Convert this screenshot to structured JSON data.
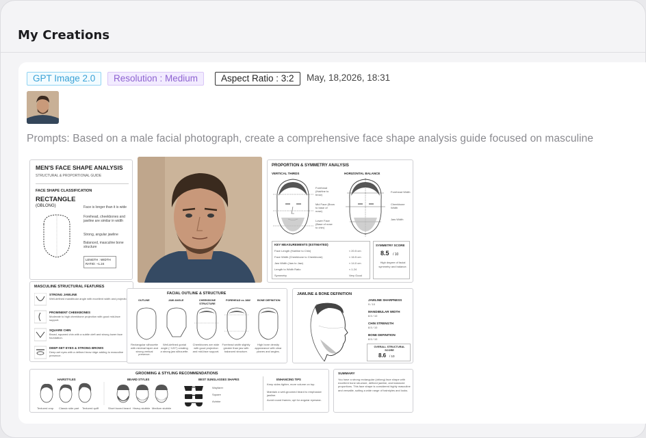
{
  "header": {
    "title": "My Creations"
  },
  "creation": {
    "model_tag": "GPT Image 2.0",
    "resolution_tag": "Resolution : Medium",
    "ratio_tag": "Aspect Ratio : 3:2",
    "date": "May, 18,2026, 18:31",
    "prompt": "Prompts: Based on a male facial photograph, create a comprehensive face shape analysis guide focused on masculine"
  },
  "poster": {
    "title": "MEN'S FACE SHAPE ANALYSIS",
    "subtitle": "STRUCTURAL & PROPORTIONAL GUIDE",
    "classification_heading": "FACE SHAPE CLASSIFICATION",
    "shape_name": "RECTANGLE",
    "shape_alt": "(OBLONG)",
    "shape_points": [
      "Face is longer than it is wide",
      "Forehead, cheekbones and jawline are similar in width",
      "Strong, angular jawline",
      "Balanced, masculine bone structure"
    ],
    "ratio_label": "LENGTH : WIDTH RATIO: ~1.24",
    "proportion_title": "PROPORTION & SYMMETRY ANALYSIS",
    "vertical_thirds": "VERTICAL THIRDS",
    "horizontal_balance": "HORIZONTAL BALANCE",
    "thirds_labels": [
      "Forehead (Hairline to brow)",
      "Mid Face (Brow to base of nose)",
      "Lower Face (Base of nose to chin)"
    ],
    "balance_labels": [
      "Forehead Width",
      "Cheekbone Width",
      "Jaw Width"
    ],
    "measure_heading": "KEY MEASUREMENTS (ESTIMATED)",
    "measurements": [
      {
        "label": "Face Length (Hairline to Chin)",
        "value": "≈ 20.5 cm"
      },
      {
        "label": "Face Width (Cheekbone to Cheekbone)",
        "value": "≈ 16.5 cm"
      },
      {
        "label": "Jaw Width (Jaw to Jaw)",
        "value": "≈ 14.0 cm"
      },
      {
        "label": "Length to Width Ratio",
        "value": "≈ 1.24"
      },
      {
        "label": "Symmetry",
        "value": "Very Good"
      }
    ],
    "symmetry_heading": "SYMMETRY SCORE",
    "symmetry_score": "8.5",
    "symmetry_outof": "/ 10",
    "symmetry_note": "High degree of facial symmetry and balance.",
    "features_title": "MASCULINE STRUCTURAL FEATURES",
    "features": [
      {
        "name": "STRONG JAWLINE",
        "desc": "Well-defined mandibular angle with excellent width and projection."
      },
      {
        "name": "PROMINENT CHEEKBONES",
        "desc": "Moderate to high cheekbone projection with good mid-face support."
      },
      {
        "name": "SQUARE CHIN",
        "desc": "Broad, squared chin with a subtle cleft and strong lower face foundation."
      },
      {
        "name": "DEEP-SET EYES & STRONG BROWS",
        "desc": "Deep-set eyes with a defined brow ridge adding to masculine presence."
      }
    ],
    "outline_title": "FACIAL OUTLINE & STRUCTURE",
    "outline_cols": [
      "OUTLINE",
      "JAW ANGLE",
      "CHEEKBONE STRUCTURE",
      "FOREHEAD vs JAW",
      "BONE DEFINITION"
    ],
    "outline_notes": [
      "Rectangular silhouette with minimal taper and strong vertical presence.",
      "Well-defined gonial angle (~120°) creating a strong jaw silhouette.",
      "Cheekbones are wide with good projection and mid-face support.",
      "Forehead width slightly greater than jaw with balanced structure.",
      "High bone density appearance with clear planes and angles."
    ],
    "jaw_title": "JAWLINE & BONE DEFINITION",
    "jaw_metrics": [
      {
        "label": "JAWLINE SHARPNESS",
        "value": "9 / 10"
      },
      {
        "label": "MANDIBULAR WIDTH",
        "value": "8.5 / 10"
      },
      {
        "label": "CHIN STRENGTH",
        "value": "8.5 / 10"
      },
      {
        "label": "BONE DEFINITION",
        "value": "8.5 / 10"
      }
    ],
    "overall_label": "OVERALL STRUCTURAL SCORE",
    "overall_score": "8.6",
    "overall_outof": "/ 10",
    "grooming_title": "GROOMING & STYLING RECOMMENDATIONS",
    "hairstyles_heading": "HAIRSTYLES",
    "hairstyles": [
      "Textured crop",
      "Classic side part",
      "Textured quiff"
    ],
    "beard_heading": "BEARD STYLES",
    "beards": [
      "Short boxed beard",
      "Heavy stubble",
      "Medium stubble"
    ],
    "sunglasses_heading": "BEST SUNGLASSES SHAPES",
    "sunglasses": [
      "Wayfarer",
      "Square",
      "Aviator"
    ],
    "tips_heading": "ENHANCING TIPS",
    "tips": [
      "Keep sides tighter, more volume on top.",
      "Maintain a well-groomed beard to emphasize jawline.",
      "Avoid round frames; opt for angular eyewear."
    ],
    "summary_heading": "SUMMARY",
    "summary_text": "You have a strong rectangular (oblong) face shape with excellent bone structure, defined jawline, and balanced proportions. This face shape is considered highly masculine and versatile, suiting a wide range of hairstyles and looks."
  },
  "colors": {
    "model_tag": "#3aa2d6",
    "resolution_tag": "#8e63d1"
  },
  "icons": {
    "thumbnail": "portrait-thumbnail-icon"
  }
}
